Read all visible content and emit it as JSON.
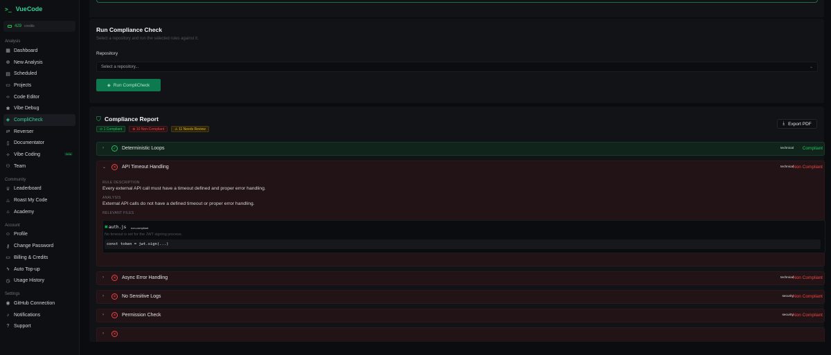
{
  "brand": {
    "prompt": ">_",
    "name": "VueCode"
  },
  "credits": {
    "amount": "429",
    "label": "credits"
  },
  "sidebar": {
    "analysis_title": "Analysis",
    "analysis_items": [
      {
        "label": "Dashboard",
        "icon": "grid-icon"
      },
      {
        "label": "New Analysis",
        "icon": "plus-circle-icon"
      },
      {
        "label": "Scheduled",
        "icon": "calendar-icon"
      },
      {
        "label": "Projects",
        "icon": "folder-icon"
      },
      {
        "label": "Code Editor",
        "icon": "code-icon"
      },
      {
        "label": "Vibe Debug",
        "icon": "bug-icon"
      },
      {
        "label": "CompliCheck",
        "icon": "shield-check-icon"
      },
      {
        "label": "Reverser",
        "icon": "reverse-icon"
      },
      {
        "label": "Documentator",
        "icon": "document-icon"
      },
      {
        "label": "Vibe Coding",
        "icon": "sparkle-icon",
        "badge": "beta"
      },
      {
        "label": "Team",
        "icon": "users-icon"
      }
    ],
    "community_title": "Community",
    "community_items": [
      {
        "label": "Leaderboard",
        "icon": "trophy-icon"
      },
      {
        "label": "Roast My Code",
        "icon": "flame-icon"
      },
      {
        "label": "Academy",
        "icon": "graduation-icon"
      }
    ],
    "account_title": "Account",
    "account_items": [
      {
        "label": "Profile",
        "icon": "user-icon"
      },
      {
        "label": "Change Password",
        "icon": "key-icon"
      },
      {
        "label": "Billing & Credits",
        "icon": "card-icon"
      },
      {
        "label": "Auto Top-up",
        "icon": "zap-icon"
      },
      {
        "label": "Usage History",
        "icon": "history-icon"
      }
    ],
    "settings_title": "Settings",
    "settings_items": [
      {
        "label": "GitHub Connection",
        "icon": "github-icon"
      },
      {
        "label": "Notifications",
        "icon": "bell-icon"
      },
      {
        "label": "Support",
        "icon": "help-icon"
      }
    ]
  },
  "run_check": {
    "title": "Run Compliance Check",
    "subtitle": "Select a repository and run the selected rules against it.",
    "repo_label": "Repository",
    "repo_placeholder": "Select a repository...",
    "button_label": "Run CompliCheck"
  },
  "report": {
    "title": "Compliance Report",
    "pills": {
      "compliant": "1 Compliant",
      "non_compliant": "10 Non-Compliant",
      "review": "11 Needs Review"
    },
    "export_label": "Export PDF",
    "rules": [
      {
        "name": "Deterministic Loops",
        "tag": "technical",
        "status": "Compliant"
      },
      {
        "name": "API Timeout Handling",
        "tag": "technical",
        "status": "Non Compliant"
      },
      {
        "name": "Async Error Handling",
        "tag": "technical",
        "status": "Non Compliant"
      },
      {
        "name": "No Sensitive Logs",
        "tag": "security",
        "status": "Non Compliant"
      },
      {
        "name": "Permission Check",
        "tag": "security",
        "status": "Non Compliant"
      }
    ],
    "expanded": {
      "rule_desc_label": "RULE DESCRIPTION",
      "rule_desc": "Every external API call must have a timeout defined and proper error handling.",
      "analysis_label": "ANALYSIS",
      "analysis": "External API calls do not have a defined timeout or proper error handling.",
      "files_label": "RELEVANT FILES",
      "file_name": "auth.js",
      "file_badge": "non-compliant",
      "file_desc": "No timeout is set for the JWT signing process.",
      "code": "const token = jwt.sign(...)"
    }
  },
  "colors": {
    "accent": "#22c55e",
    "danger": "#ef4444",
    "warning": "#eab308"
  }
}
